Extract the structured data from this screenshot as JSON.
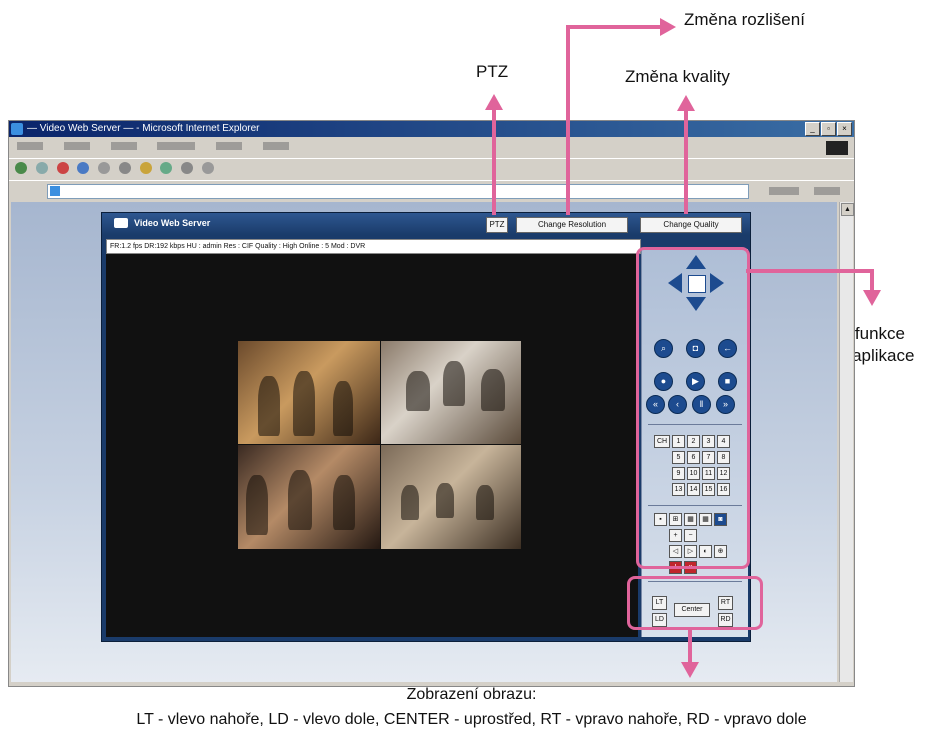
{
  "callouts": {
    "ptz": "PTZ",
    "resolution": "Změna rozlišení",
    "quality": "Změna kvality",
    "same_functions_line1": "Stejné funkce",
    "same_functions_line2": "jako u aplikace",
    "display_title": "Zobrazení obrazu:",
    "display_legend": "LT - vlevo nahoře, LD - vlevo dole, CENTER - uprostřed, RT - vpravo nahoře, RD - vpravo dole"
  },
  "browser": {
    "title": "— Video Web Server — - Microsoft Internet Explorer",
    "window_buttons": [
      "_",
      "▫",
      "×"
    ]
  },
  "app": {
    "title": "Video Web Server",
    "ptz_button": "PTZ",
    "change_resolution": "Change Resolution",
    "change_quality": "Change Quality",
    "status": "FR:1.2 fps  DR:192 kbps  HU : admin  Res : CIF  Quality : High  Online : 5 Mod : DVR",
    "channel_labels": [
      "CH",
      "1",
      "2",
      "3",
      "4",
      "5",
      "6",
      "7",
      "8",
      "9",
      "10",
      "11",
      "12",
      "13",
      "14",
      "15",
      "16"
    ],
    "position_buttons": {
      "lt": "LT",
      "ld": "LD",
      "center": "Center",
      "rt": "RT",
      "rd": "RD"
    }
  },
  "colors": {
    "highlight": "#e0649b",
    "app_frame": "#1a3b6a",
    "control_button": "#1d4b8f"
  }
}
